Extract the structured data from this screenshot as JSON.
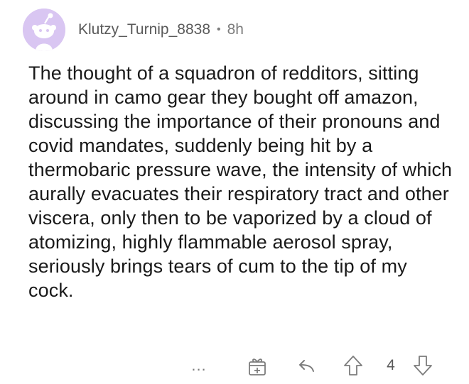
{
  "comment": {
    "username": "Klutzy_Turnip_8838",
    "separator": "•",
    "age": "8h",
    "body": "The thought of a squadron of redditors, sitting around in camo gear they bought off amazon, discussing the importance of their pronouns and covid mandates, suddenly being hit by a thermobaric pressure wave, the intensity of which aurally evacuates their respiratory tract and other viscera, only then to be vaporized by a cloud of atomizing, highly flammable aerosol spray, seriously brings tears of cum to the tip of my cock.",
    "score": "4"
  },
  "actions": {
    "more_label": "...",
    "icons": [
      "more-icon",
      "award-icon",
      "reply-icon",
      "upvote-icon",
      "downvote-icon"
    ]
  },
  "colors": {
    "avatar_bg": "#d9c6f2",
    "text": "#1a1a1a",
    "meta": "#5f5f5f"
  }
}
